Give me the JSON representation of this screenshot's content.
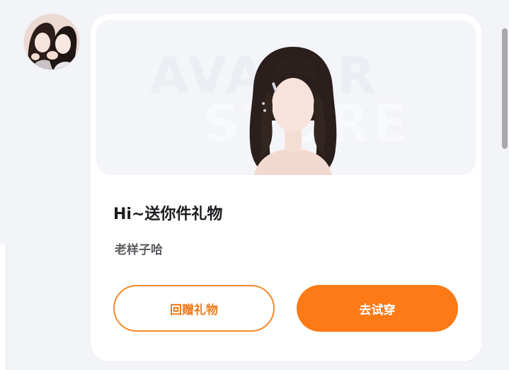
{
  "avatar": {
    "icon": "user-avatar-photo"
  },
  "card": {
    "banner": {
      "watermark_line1": "AVATAR",
      "watermark_line2": "STORE",
      "illustration_icon": "hairstyle-illustration"
    },
    "title": "Hi~送你件礼物",
    "subtitle": "老样子哈",
    "buttons": {
      "return_gift": "回赠礼物",
      "try_on": "去试穿"
    }
  },
  "colors": {
    "accent": "#fd7a16",
    "accent_border": "#f58a2a",
    "page_background": "#f3f4f8",
    "card_background": "#ffffff"
  }
}
